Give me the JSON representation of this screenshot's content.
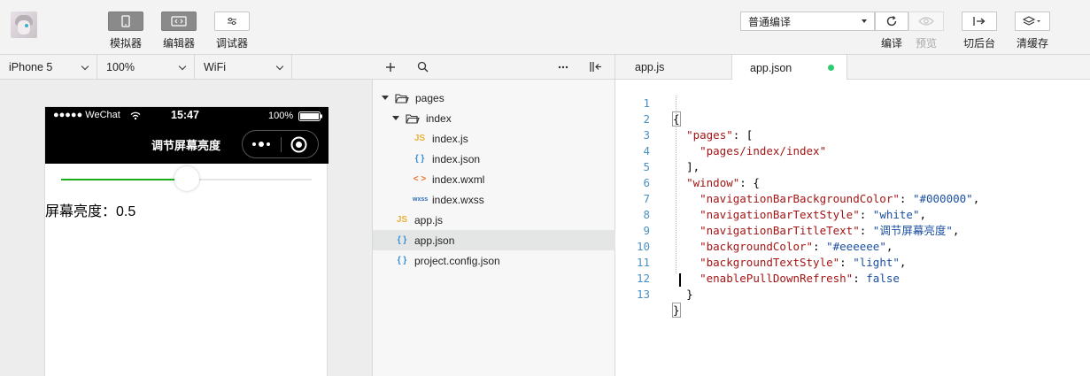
{
  "toolbar": {
    "simulator_label": "模拟器",
    "editor_label": "编辑器",
    "debugger_label": "调试器",
    "compile_mode": "普通编译",
    "compile_label": "编译",
    "preview_label": "预览",
    "background_label": "切后台",
    "clear_cache_label": "清缓存"
  },
  "device_bar": {
    "device": "iPhone 5",
    "zoom": "100%",
    "network": "WiFi"
  },
  "phone": {
    "carrier": "●●●●● WeChat",
    "time": "15:47",
    "battery": "100%",
    "nav_title": "调节屏幕亮度",
    "slider_value": 0.5,
    "brightness_text": "屏幕亮度：0.5"
  },
  "explorer": {
    "tree": [
      {
        "label": "pages",
        "type": "folder"
      },
      {
        "label": "index",
        "type": "folder"
      },
      {
        "label": "index.js",
        "type": "js",
        "icon": "JS"
      },
      {
        "label": "index.json",
        "type": "json",
        "icon": "{ }"
      },
      {
        "label": "index.wxml",
        "type": "wxml",
        "icon": "< >"
      },
      {
        "label": "index.wxss",
        "type": "wxss",
        "icon": "wxss"
      },
      {
        "label": "app.js",
        "type": "js",
        "icon": "JS"
      },
      {
        "label": "app.json",
        "type": "json",
        "icon": "{ }",
        "selected": true
      },
      {
        "label": "project.config.json",
        "type": "json",
        "icon": "{ }"
      }
    ]
  },
  "editor": {
    "tabs": [
      {
        "label": "app.js",
        "active": false
      },
      {
        "label": "app.json",
        "active": true,
        "modified": true
      }
    ],
    "line_numbers": [
      "1",
      "2",
      "3",
      "4",
      "5",
      "6",
      "7",
      "8",
      "9",
      "10",
      "11",
      "12",
      "13"
    ]
  },
  "colors": {
    "accent_green": "#1aad19",
    "modified_dot": "#2ecc71",
    "line_number": "#4a90c2"
  }
}
